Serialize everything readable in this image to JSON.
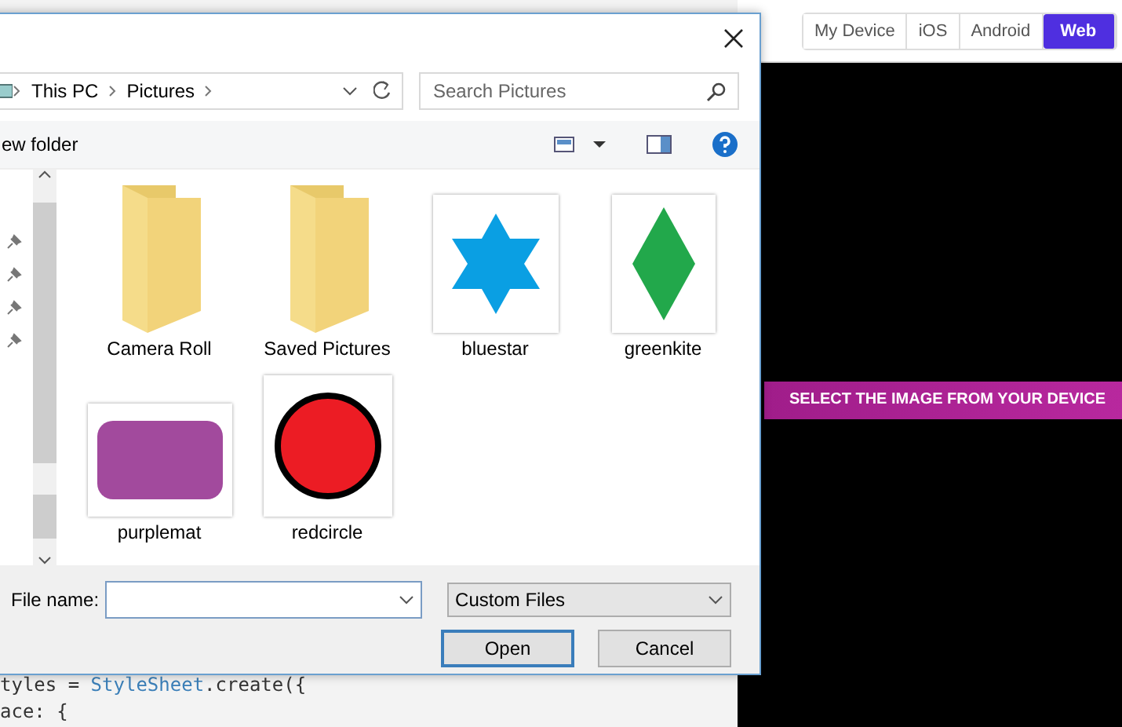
{
  "editor": {
    "code_lines": [
      {
        "parts": [
          {
            "text": "tyles = ",
            "kind": "plain"
          },
          {
            "text": "StyleSheet",
            "kind": "type"
          },
          {
            "text": ".create({",
            "kind": "plain"
          }
        ]
      },
      {
        "parts": [
          {
            "text": "ace: {",
            "kind": "plain"
          }
        ]
      }
    ]
  },
  "preview": {
    "tabs": [
      {
        "label": "My Device",
        "selected": false
      },
      {
        "label": "iOS",
        "selected": false
      },
      {
        "label": "Android",
        "selected": false
      },
      {
        "label": "Web",
        "selected": true
      }
    ],
    "banner": "SELECT THE IMAGE FROM YOUR DEVICE"
  },
  "dialog": {
    "breadcrumb": [
      "This PC",
      "Pictures"
    ],
    "search": {
      "placeholder": "Search Pictures"
    },
    "toolbar": {
      "new_folder": "ew folder"
    },
    "files": [
      {
        "name": "Camera Roll",
        "kind": "folder"
      },
      {
        "name": "Saved Pictures",
        "kind": "folder"
      },
      {
        "name": "bluestar",
        "kind": "star"
      },
      {
        "name": "greenkite",
        "kind": "kite"
      },
      {
        "name": "purplemat",
        "kind": "mat"
      },
      {
        "name": "redcircle",
        "kind": "circle"
      }
    ],
    "file_name": {
      "label": "File name:"
    },
    "filter": "Custom Files",
    "buttons": [
      {
        "label": "Open",
        "default": true
      },
      {
        "label": "Cancel",
        "default": false
      }
    ]
  }
}
